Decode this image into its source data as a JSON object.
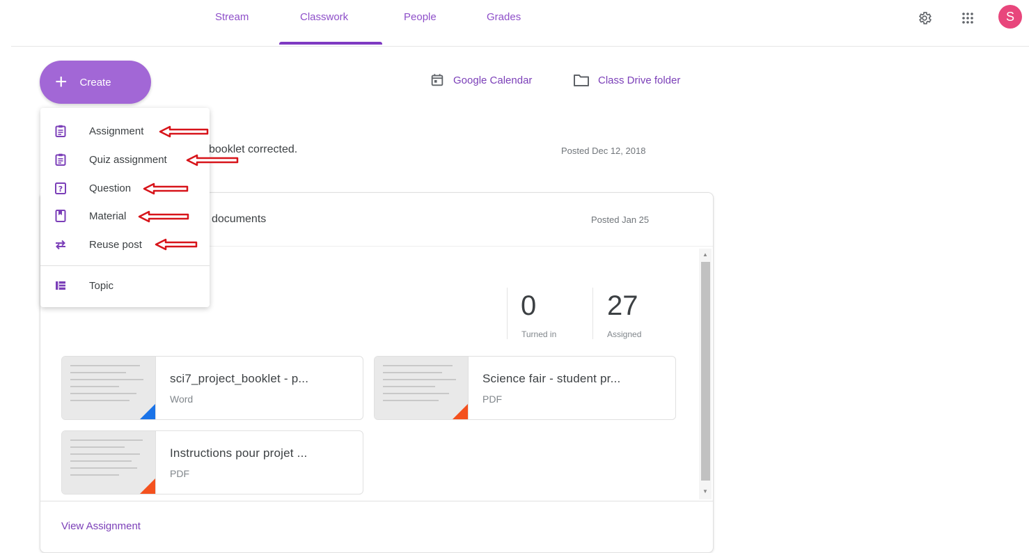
{
  "nav": {
    "tabs": [
      {
        "label": "Stream"
      },
      {
        "label": "Classwork"
      },
      {
        "label": "People"
      },
      {
        "label": "Grades"
      }
    ],
    "active_tab": "Classwork",
    "icons": [
      "settings-icon",
      "apps-grid-icon"
    ],
    "avatar_letter": "S",
    "avatar_color": "#e8467c"
  },
  "toolbar": {
    "create_label": "Create",
    "create_icon": "plus-icon",
    "calendar_link": "Google Calendar",
    "drive_link": "Class Drive folder"
  },
  "create_menu": {
    "items": [
      {
        "label": "Assignment",
        "icon": "assignment-icon"
      },
      {
        "label": "Quiz assignment",
        "icon": "quiz-assignment-icon"
      },
      {
        "label": "Question",
        "icon": "question-icon"
      },
      {
        "label": "Material",
        "icon": "material-icon"
      },
      {
        "label": "Reuse post",
        "icon": "reuse-post-icon"
      },
      {
        "label": "Topic",
        "icon": "topic-icon"
      }
    ],
    "annotation_arrows_color": "#d7141a"
  },
  "stream": {
    "item1_text": "booklet corrected.",
    "item1_posted": "Posted Dec 12, 2018",
    "item2_text": "documents",
    "item2_posted": "Posted Jan 25"
  },
  "assignment_card": {
    "turned_in_count": "0",
    "turned_in_label": "Turned in",
    "assigned_count": "27",
    "assigned_label": "Assigned",
    "attachments": [
      {
        "title": "sci7_project_booklet - p...",
        "type": "Word",
        "corner_color": "#1a73e8"
      },
      {
        "title": "Science fair - student pr...",
        "type": "PDF",
        "corner_color": "#f4511e"
      },
      {
        "title": "Instructions pour projet ...",
        "type": "PDF",
        "corner_color": "#f4511e"
      }
    ],
    "view_link": "View Assignment"
  },
  "colors": {
    "accent": "#7e3ac2",
    "create_button": "#a267d6"
  }
}
